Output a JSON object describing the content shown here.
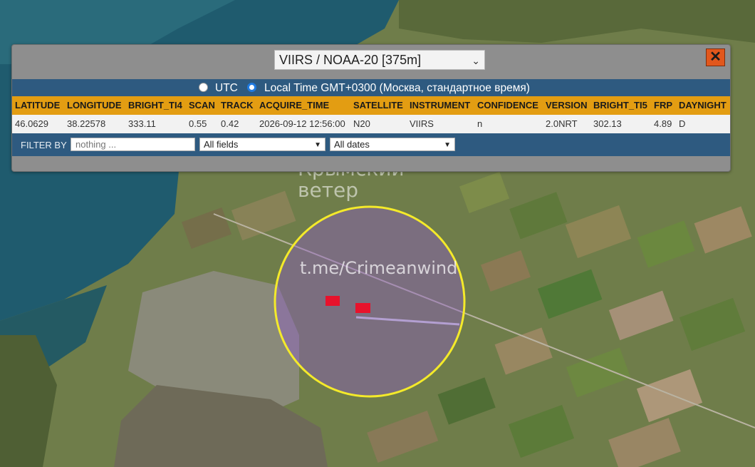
{
  "satellite_select": {
    "value": "VIIRS / NOAA-20 [375m]"
  },
  "close_label": "✕",
  "timezone": {
    "utc_label": "UTC",
    "local_label": "Local Time GMT+0300 (Москва, стандартное время)",
    "selected": "local"
  },
  "table": {
    "headers": [
      "LATITUDE",
      "LONGITUDE",
      "BRIGHT_TI4",
      "SCAN",
      "TRACK",
      "ACQUIRE_TIME",
      "SATELLITE",
      "INSTRUMENT",
      "CONFIDENCE",
      "VERSION",
      "BRIGHT_TI5",
      "FRP",
      "DAYNIGHT"
    ],
    "row": [
      "46.0629",
      "38.22578",
      "333.11",
      "0.55",
      "0.42",
      "2026-09-12 12:56:00",
      "N20",
      "VIIRS",
      "n",
      "2.0NRT",
      "302.13",
      "4.89",
      "D"
    ]
  },
  "filter": {
    "label": "FILTER BY",
    "placeholder": "nothing ...",
    "fields_value": "All fields",
    "dates_value": "All dates"
  },
  "watermark": {
    "logo_line1": "Крымский",
    "logo_line2": "ветер",
    "link": "t.me/Crimeanwind"
  },
  "colors": {
    "header_bg": "#e39d12",
    "bar_bg": "#2e5a80",
    "close_bg": "#e2571c",
    "circle": "#f4ea2a",
    "fire_marker": "#e8122c"
  }
}
